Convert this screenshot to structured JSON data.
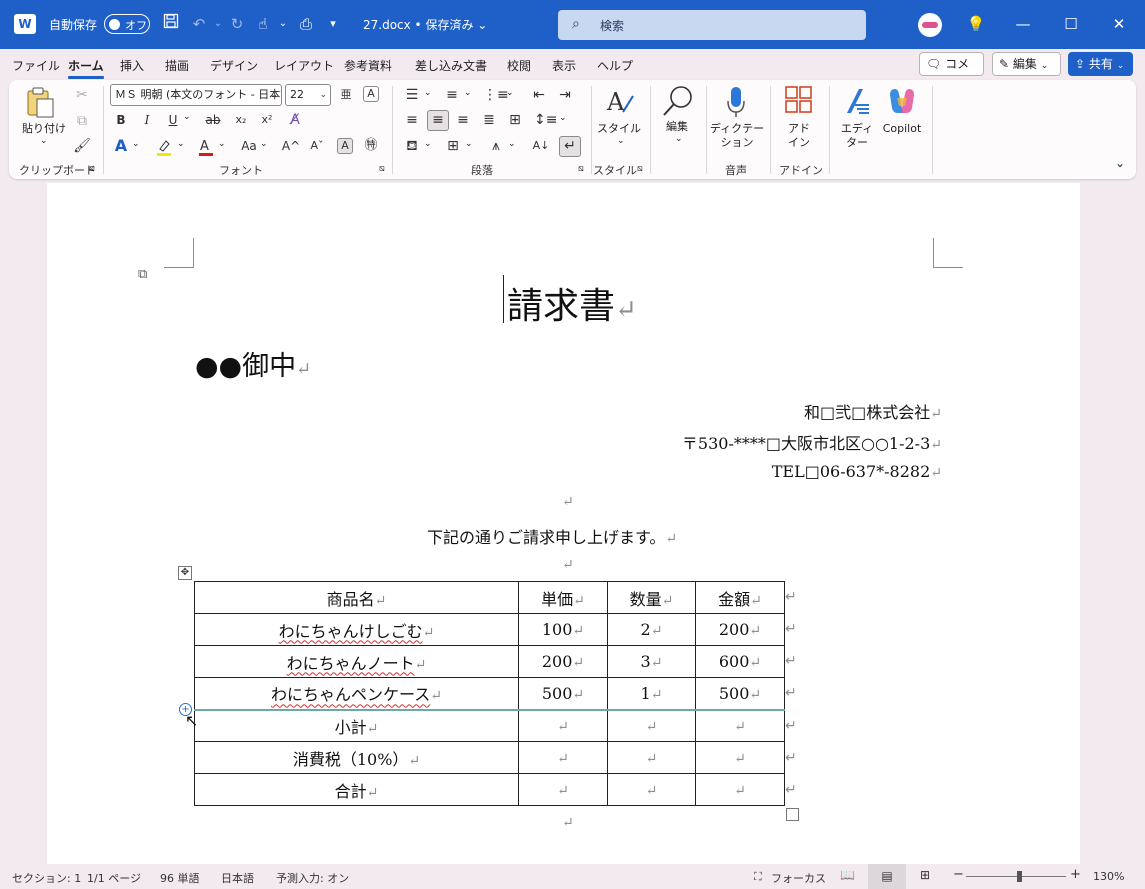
{
  "titlebar": {
    "app_letter": "W",
    "autosave_label": "自動保存",
    "autosave_state": "オフ",
    "doc_title": "27.docx • 保存済み",
    "search_placeholder": "検索"
  },
  "menu": {
    "tabs": [
      "ファイル",
      "ホーム",
      "挿入",
      "描画",
      "デザイン",
      "レイアウト",
      "参考資料",
      "差し込み文書",
      "校閲",
      "表示",
      "ヘルプ"
    ],
    "active_tab": "ホーム",
    "comment_label": "コメント",
    "edit_label": "編集",
    "share_label": "共有"
  },
  "ribbon": {
    "clipboard": {
      "paste_label": "貼り付け",
      "group_label": "クリップボード"
    },
    "font": {
      "font_name": "ＭＳ 明朝 (本文のフォント - 日本語)",
      "font_size": "22",
      "group_label": "フォント",
      "bold": "B",
      "italic": "I",
      "underline": "U",
      "strike": "ab",
      "subscript": "x₂",
      "superscript": "x²",
      "change_case": "Aa",
      "grow": "A^",
      "shrink": "Aˇ"
    },
    "paragraph": {
      "group_label": "段落"
    },
    "styles": {
      "label": "スタイル",
      "group_label": "スタイル"
    },
    "editing": {
      "label": "編集"
    },
    "voice": {
      "label_line1": "ディクテー",
      "label_line2": "ション",
      "group_label": "音声"
    },
    "addins": {
      "label_line1": "アド",
      "label_line2": "イン",
      "group_label": "アドイン"
    },
    "editor": {
      "label_line1": "エディ",
      "label_line2": "ター"
    },
    "copilot": {
      "label": "Copilot"
    }
  },
  "document": {
    "title": "請求書",
    "addressee": "●●御中",
    "sender_company": "和□弐□株式会社",
    "sender_address": "〒530-****□大阪市北区○○1-2-3",
    "sender_tel": "TEL□06-637*-8282",
    "intro": "下記の通りご請求申し上げます。",
    "return_mark": "↵",
    "table": {
      "headers": [
        "商品名",
        "単価",
        "数量",
        "金額"
      ],
      "rows": [
        [
          "わにちゃんけしごむ",
          "100",
          "2",
          "200"
        ],
        [
          "わにちゃんノート",
          "200",
          "3",
          "600"
        ],
        [
          "わにちゃんペンケース",
          "500",
          "1",
          "500"
        ],
        [
          "小計",
          "",
          "",
          ""
        ],
        [
          "消費税（10%）",
          "",
          "",
          ""
        ],
        [
          "合計",
          "",
          "",
          ""
        ]
      ]
    }
  },
  "statusbar": {
    "section": "セクション: 1",
    "page": "1/1 ページ",
    "words": "96 単語",
    "language": "日本語",
    "predict": "予測入力: オン",
    "focus": "フォーカス",
    "zoom": "130%"
  },
  "colors": {
    "brand": "#1f5fc8",
    "page_bg": "#ffffff",
    "window_bg": "#f3eaf0"
  }
}
